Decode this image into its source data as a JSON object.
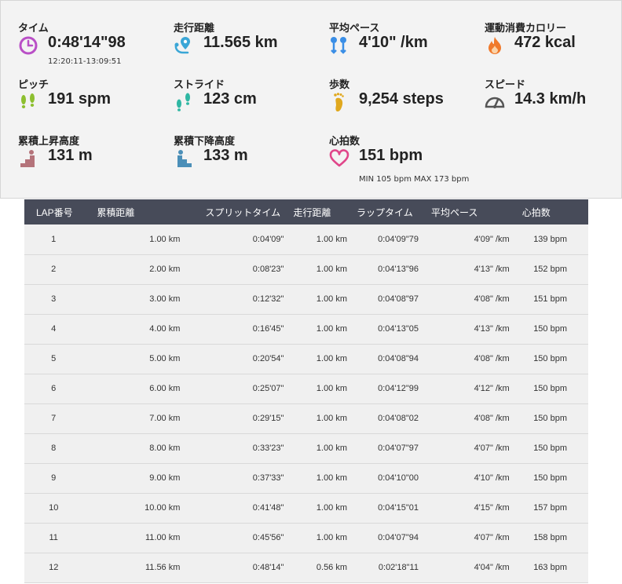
{
  "summary": {
    "time": {
      "label": "タイム",
      "value": "0:48'14\"98",
      "sub": "12:20:11-13:09:51",
      "icon": "clock-icon",
      "color": "#b94fc6"
    },
    "distance": {
      "label": "走行距離",
      "value": "11.565 km",
      "icon": "route-pin-icon",
      "color": "#3aa6d6"
    },
    "pace": {
      "label": "平均ペース",
      "value": "4'10\" /km",
      "icon": "pace-icon",
      "color": "#3a8ee6"
    },
    "calories": {
      "label": "運動消費カロリー",
      "value": "472 kcal",
      "icon": "flame-icon",
      "color": "#f07a2c"
    },
    "pitch": {
      "label": "ピッチ",
      "value": "191 spm",
      "icon": "footsteps-icon",
      "color": "#8dbf2f"
    },
    "stride": {
      "label": "ストライド",
      "value": "123 cm",
      "icon": "stride-icon",
      "color": "#2fb7a3"
    },
    "steps": {
      "label": "歩数",
      "value": "9,254 steps",
      "icon": "footprint-icon",
      "color": "#e0a81e"
    },
    "speed": {
      "label": "スピード",
      "value": "14.3 km/h",
      "icon": "speedometer-icon",
      "color": "#555555"
    },
    "ascent": {
      "label": "累積上昇高度",
      "value": "131 m",
      "icon": "ascent-icon",
      "color": "#b4737a"
    },
    "descent": {
      "label": "累積下降高度",
      "value": "133 m",
      "icon": "descent-icon",
      "color": "#4b8fb8"
    },
    "heart": {
      "label": "心拍数",
      "value": "151 bpm",
      "sub": "MIN 105 bpm MAX 173 bpm",
      "icon": "heart-icon",
      "color": "#e0468a"
    }
  },
  "laps": {
    "headers": [
      "LAP番号",
      "累積距離",
      "スプリットタイム",
      "走行距離",
      "ラップタイム",
      "平均ペース",
      "心拍数"
    ],
    "rows": [
      [
        "1",
        "1.00 km",
        "0:04'09\"",
        "1.00 km",
        "0:04'09\"79",
        "4'09\" /km",
        "139 bpm"
      ],
      [
        "2",
        "2.00 km",
        "0:08'23\"",
        "1.00 km",
        "0:04'13\"96",
        "4'13\" /km",
        "152 bpm"
      ],
      [
        "3",
        "3.00 km",
        "0:12'32\"",
        "1.00 km",
        "0:04'08\"97",
        "4'08\" /km",
        "151 bpm"
      ],
      [
        "4",
        "4.00 km",
        "0:16'45\"",
        "1.00 km",
        "0:04'13\"05",
        "4'13\" /km",
        "150 bpm"
      ],
      [
        "5",
        "5.00 km",
        "0:20'54\"",
        "1.00 km",
        "0:04'08\"94",
        "4'08\" /km",
        "150 bpm"
      ],
      [
        "6",
        "6.00 km",
        "0:25'07\"",
        "1.00 km",
        "0:04'12\"99",
        "4'12\" /km",
        "150 bpm"
      ],
      [
        "7",
        "7.00 km",
        "0:29'15\"",
        "1.00 km",
        "0:04'08\"02",
        "4'08\" /km",
        "150 bpm"
      ],
      [
        "8",
        "8.00 km",
        "0:33'23\"",
        "1.00 km",
        "0:04'07\"97",
        "4'07\" /km",
        "150 bpm"
      ],
      [
        "9",
        "9.00 km",
        "0:37'33\"",
        "1.00 km",
        "0:04'10\"00",
        "4'10\" /km",
        "150 bpm"
      ],
      [
        "10",
        "10.00 km",
        "0:41'48\"",
        "1.00 km",
        "0:04'15\"01",
        "4'15\" /km",
        "157 bpm"
      ],
      [
        "11",
        "11.00 km",
        "0:45'56\"",
        "1.00 km",
        "0:04'07\"94",
        "4'07\" /km",
        "158 bpm"
      ],
      [
        "12",
        "11.56 km",
        "0:48'14\"",
        "0.56 km",
        "0:02'18\"11",
        "4'04\" /km",
        "163 bpm"
      ]
    ]
  }
}
